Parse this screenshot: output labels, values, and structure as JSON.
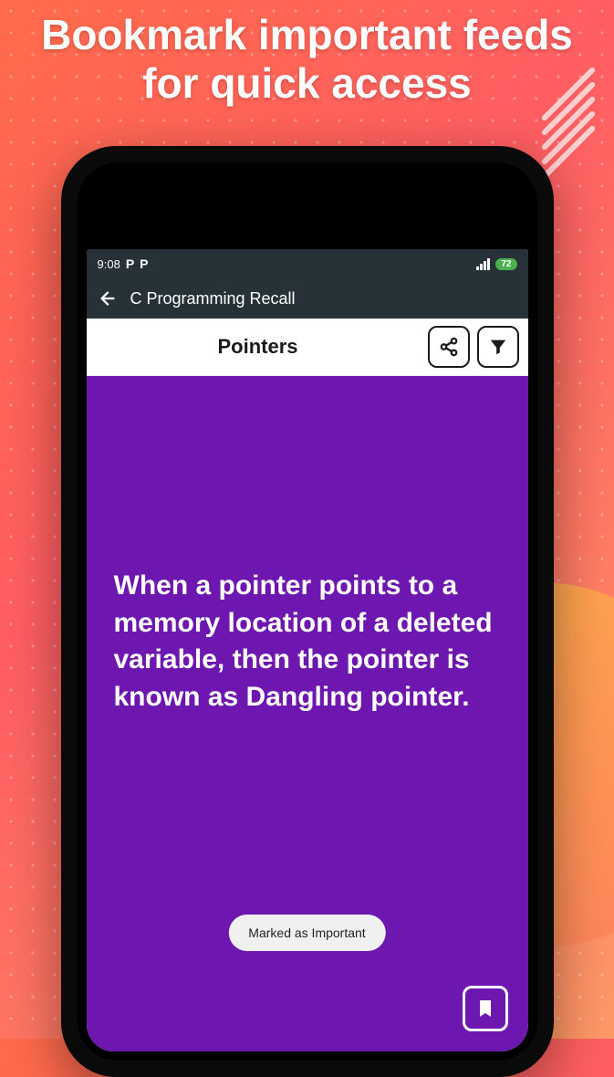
{
  "promo": {
    "headline": "Bookmark important feeds for quick access"
  },
  "statusBar": {
    "time": "9:08",
    "batteryLevel": "72"
  },
  "appBar": {
    "title": "C Programming Recall"
  },
  "toolbar": {
    "title": "Pointers"
  },
  "card": {
    "body": "When a pointer points to a memory location of a deleted variable, then the pointer is known as Dangling pointer."
  },
  "toast": {
    "message": "Marked as Important"
  }
}
